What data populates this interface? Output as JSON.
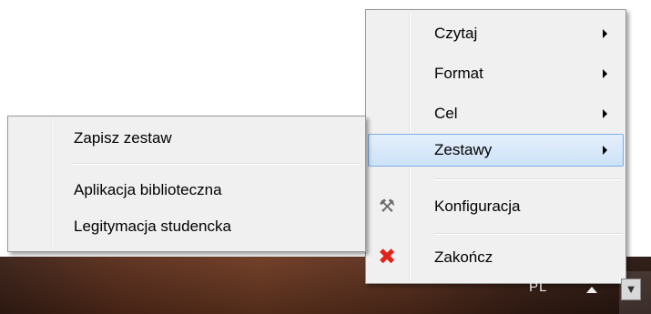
{
  "main_menu": {
    "items": [
      {
        "label": "Czytaj",
        "submenu": true
      },
      {
        "label": "Format",
        "submenu": true
      },
      {
        "label": "Cel",
        "submenu": true
      },
      {
        "label": "Zestawy",
        "submenu": true,
        "highlighted": true
      },
      {
        "label": "Konfiguracja",
        "icon": "tools-icon"
      },
      {
        "label": "Zakończ",
        "icon": "close-icon"
      }
    ]
  },
  "sub_menu": {
    "items": [
      {
        "label": "Zapisz zestaw"
      },
      {
        "label": "Aplikacja biblioteczna"
      },
      {
        "label": "Legitymacja studencka"
      }
    ]
  },
  "taskbar": {
    "language": "PL"
  },
  "colors": {
    "menu_bg": "#f0f0f0",
    "highlight_border": "#7aaee6",
    "exit_icon": "#e2231a"
  }
}
